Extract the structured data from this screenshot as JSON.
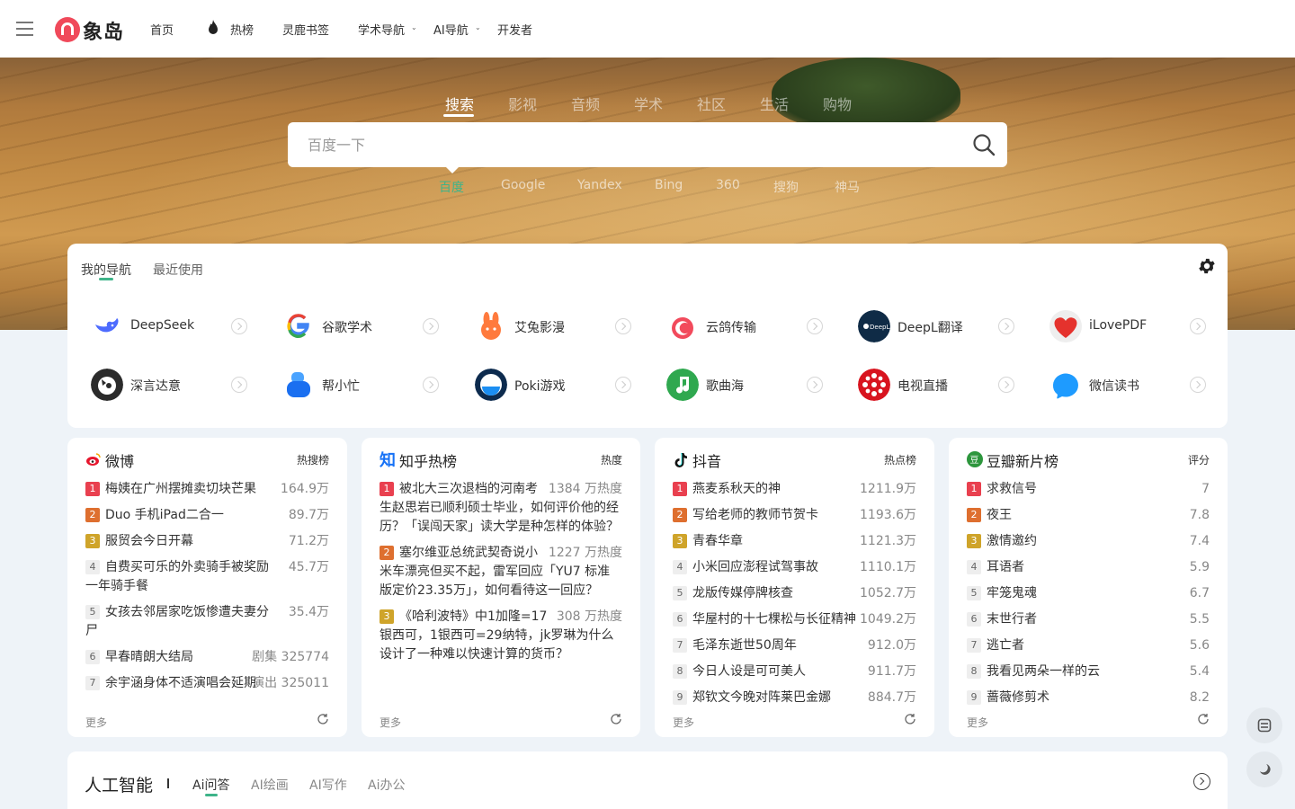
{
  "header": {
    "logo_text": "象岛",
    "nav": [
      "首页",
      "热榜",
      "灵鹿书签",
      "学术导航",
      "AI导航",
      "开发者"
    ]
  },
  "search": {
    "tabs": [
      "搜索",
      "影视",
      "音频",
      "学术",
      "社区",
      "生活",
      "购物"
    ],
    "active_tab": "搜索",
    "placeholder": "百度一下",
    "engines": [
      "百度",
      "Google",
      "Yandex",
      "Bing",
      "360",
      "搜狗",
      "神马"
    ],
    "active_engine": "百度"
  },
  "my_nav": {
    "tabs": [
      "我的导航",
      "最近使用"
    ],
    "sites": [
      {
        "label": "DeepSeek",
        "icon": "deepseek-icon"
      },
      {
        "label": "谷歌学术",
        "icon": "google-scholar-icon"
      },
      {
        "label": "艾兔影漫",
        "icon": "aitu-rabbit-icon"
      },
      {
        "label": "云鸽传输",
        "icon": "yunge-icon"
      },
      {
        "label": "DeepL翻译",
        "icon": "deepl-icon"
      },
      {
        "label": "iLovePDF",
        "icon": "ilovepdf-heart-icon"
      },
      {
        "label": "深言达意",
        "icon": "shenyan-icon"
      },
      {
        "label": "帮小忙",
        "icon": "bangxiaomang-icon"
      },
      {
        "label": "Poki游戏",
        "icon": "poki-icon"
      },
      {
        "label": "歌曲海",
        "icon": "music-note-icon"
      },
      {
        "label": "电视直播",
        "icon": "tv-live-icon"
      },
      {
        "label": "微信读书",
        "icon": "weread-icon"
      }
    ]
  },
  "hot_boards": [
    {
      "title": "微博",
      "sub": "热搜榜",
      "more": "更多",
      "items": [
        {
          "rank": "1",
          "title": "梅姨在广州摆摊卖切块芒果",
          "value": "164.9万"
        },
        {
          "rank": "2",
          "title": "Duo 手机iPad二合一",
          "value": "89.7万"
        },
        {
          "rank": "3",
          "title": "服贸会今日开幕",
          "value": "71.2万"
        },
        {
          "rank": "4",
          "title": "自费买可乐的外卖骑手被奖励一年骑手餐",
          "value": "45.7万"
        },
        {
          "rank": "5",
          "title": "女孩去邻居家吃饭惨遭夫妻分尸",
          "value": "35.4万"
        },
        {
          "rank": "6",
          "title": "早春晴朗大结局",
          "value": "剧集 325774"
        },
        {
          "rank": "7",
          "title": "余宇涵身体不适演唱会延期",
          "value": "演出 325011"
        }
      ]
    },
    {
      "title": "知乎热榜",
      "sub": "热度",
      "more": "更多",
      "items": [
        {
          "rank": "1",
          "title": "被北大三次退档的河南考生赵思岩已顺利硕士毕业，如何评价他的经历？「误闯天家」读大学是种怎样的体验？",
          "value": "1384 万热度"
        },
        {
          "rank": "2",
          "title": "塞尔维亚总统武契奇说小米车漂亮但买不起，雷军回应「YU7 标准版定价23.35万」，如何看待这一回应？",
          "value": "1227 万热度"
        },
        {
          "rank": "3",
          "title": "《哈利波特》中1加隆=17银西可，1银西可=29纳特，jk罗琳为什么设计了一种难以快速计算的货币？",
          "value": "308 万热度"
        }
      ]
    },
    {
      "title": "抖音",
      "sub": "热点榜",
      "more": "更多",
      "items": [
        {
          "rank": "1",
          "title": "燕麦系秋天的神",
          "value": "1211.9万"
        },
        {
          "rank": "2",
          "title": "写给老师的教师节贺卡",
          "value": "1193.6万"
        },
        {
          "rank": "3",
          "title": "青春华章",
          "value": "1121.3万"
        },
        {
          "rank": "4",
          "title": "小米回应澎程试驾事故",
          "value": "1110.1万"
        },
        {
          "rank": "5",
          "title": "龙版传媒停牌核查",
          "value": "1052.7万"
        },
        {
          "rank": "6",
          "title": "华屋村的十七棵松与长征精神",
          "value": "1049.2万"
        },
        {
          "rank": "7",
          "title": "毛泽东逝世50周年",
          "value": "912.0万"
        },
        {
          "rank": "8",
          "title": "今日人设是可可美人",
          "value": "911.7万"
        },
        {
          "rank": "9",
          "title": "郑钦文今晚对阵莱巴金娜",
          "value": "884.7万"
        }
      ]
    },
    {
      "title": "豆瓣新片榜",
      "sub": "评分",
      "more": "更多",
      "items": [
        {
          "rank": "1",
          "title": "求救信号",
          "value": "7"
        },
        {
          "rank": "2",
          "title": "夜王",
          "value": "7.8"
        },
        {
          "rank": "3",
          "title": "激情邀约",
          "value": "7.4"
        },
        {
          "rank": "4",
          "title": "耳语者",
          "value": "5.9"
        },
        {
          "rank": "5",
          "title": "牢笼鬼魂",
          "value": "6.7"
        },
        {
          "rank": "6",
          "title": "末世行者",
          "value": "5.5"
        },
        {
          "rank": "7",
          "title": "逃亡者",
          "value": "5.6"
        },
        {
          "rank": "8",
          "title": "我看见两朵一样的云",
          "value": "5.4"
        },
        {
          "rank": "9",
          "title": "蔷薇修剪术",
          "value": "8.2"
        }
      ]
    }
  ],
  "ai_section": {
    "title": "人工智能",
    "tabs": [
      "Ai问答",
      "AI绘画",
      "AI写作",
      "Ai办公"
    ],
    "active_tab": "Ai问答"
  },
  "colors": {
    "accent": "#3eb489",
    "brand": "#f0495a",
    "rank1": "#e9404f",
    "rank2": "#de6f2f",
    "rank3": "#cfa42a"
  }
}
